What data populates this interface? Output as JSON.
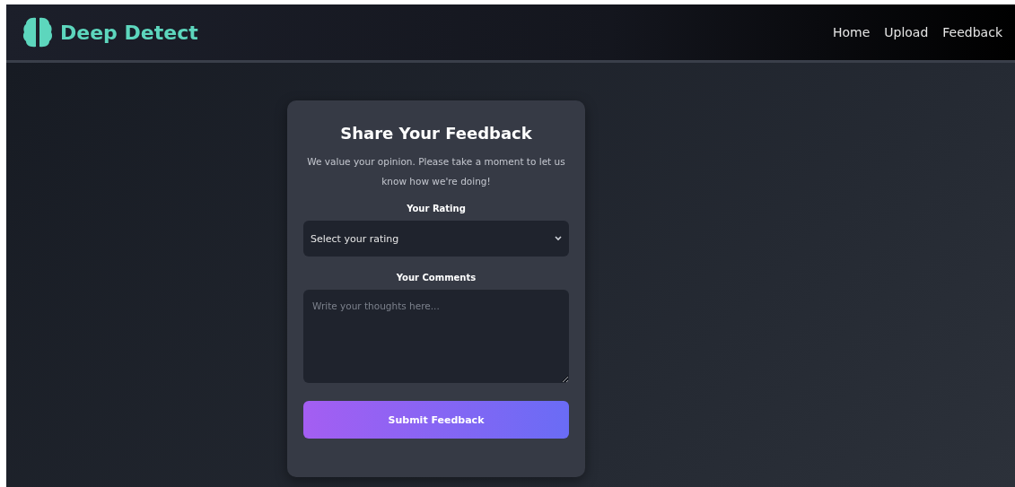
{
  "navbar": {
    "brand": "Deep Detect",
    "links": [
      {
        "label": "Home"
      },
      {
        "label": "Upload"
      },
      {
        "label": "Feedback"
      }
    ]
  },
  "feedback_form": {
    "title": "Share Your Feedback",
    "description": "We value your opinion. Please take a moment to let us know how we're doing!",
    "rating": {
      "label": "Your Rating",
      "value": "Select your rating"
    },
    "comments": {
      "label": "Your Comments",
      "placeholder": "Write your thoughts here..."
    },
    "submit_button": "Submit Feedback"
  }
}
